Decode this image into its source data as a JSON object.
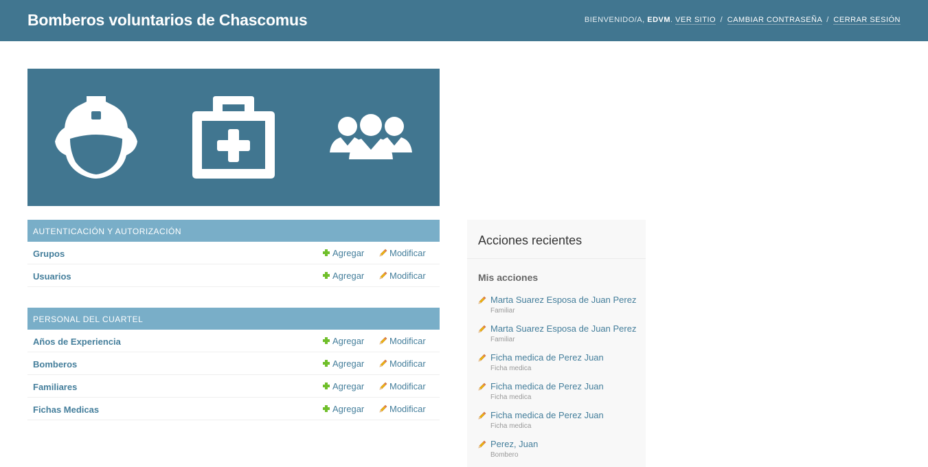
{
  "header": {
    "site_title": "Bomberos voluntarios de Chascomus",
    "welcome": "Bienvenido/a,",
    "username": "EDVM",
    "view_site": "Ver sitio",
    "change_password": "Cambiar contraseña",
    "logout": "Cerrar sesión",
    "separator": "/"
  },
  "banner": {
    "icons": [
      "firefighter-helmet-icon",
      "medical-kit-icon",
      "people-group-icon"
    ]
  },
  "modules": [
    {
      "caption": "Autenticación y autorización",
      "rows": [
        {
          "name": "Grupos",
          "add": "Agregar",
          "change": "Modificar"
        },
        {
          "name": "Usuarios",
          "add": "Agregar",
          "change": "Modificar"
        }
      ]
    },
    {
      "caption": "Personal del cuartel",
      "rows": [
        {
          "name": "Años de Experiencia",
          "add": "Agregar",
          "change": "Modificar"
        },
        {
          "name": "Bomberos",
          "add": "Agregar",
          "change": "Modificar"
        },
        {
          "name": "Familiares",
          "add": "Agregar",
          "change": "Modificar"
        },
        {
          "name": "Fichas Medicas",
          "add": "Agregar",
          "change": "Modificar"
        }
      ]
    }
  ],
  "recent_actions": {
    "title": "Acciones recientes",
    "subtitle": "Mis acciones",
    "items": [
      {
        "title": "Marta Suarez Esposa de Juan Perez",
        "type": "Familiar"
      },
      {
        "title": "Marta Suarez Esposa de Juan Perez",
        "type": "Familiar"
      },
      {
        "title": "Ficha medica de Perez Juan",
        "type": "Ficha medica"
      },
      {
        "title": "Ficha medica de Perez Juan",
        "type": "Ficha medica"
      },
      {
        "title": "Ficha medica de Perez Juan",
        "type": "Ficha medica"
      },
      {
        "title": "Perez, Juan",
        "type": "Bombero"
      }
    ]
  },
  "colors": {
    "header_bg": "#417690",
    "module_caption_bg": "#79aec8",
    "link": "#447e9b",
    "add_icon": "#70bf2b",
    "sidebar_bg": "#f8f8f8"
  }
}
